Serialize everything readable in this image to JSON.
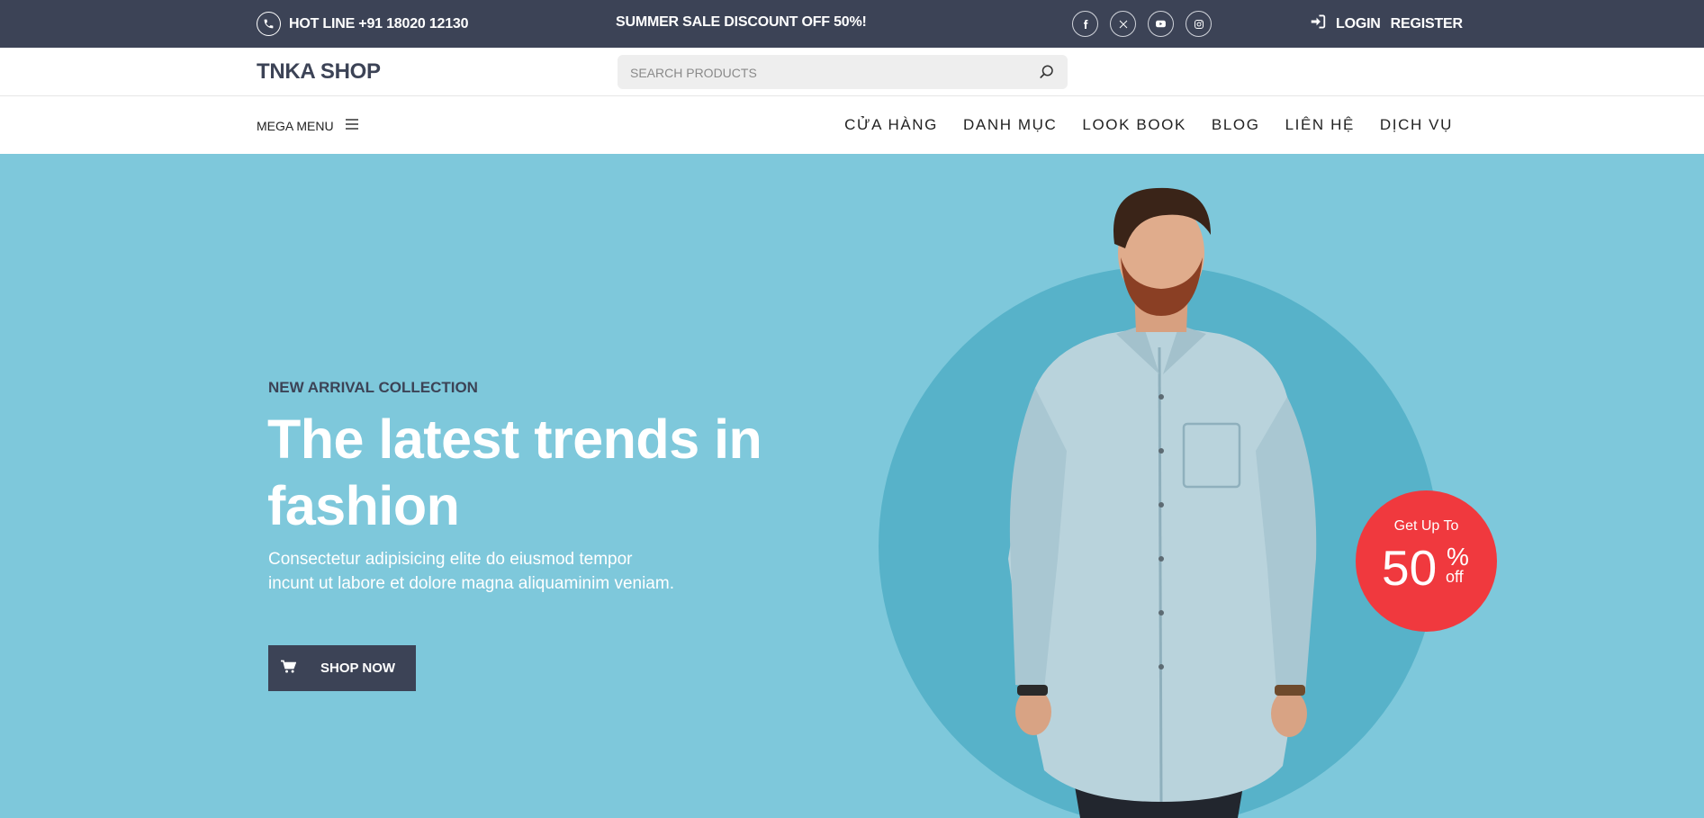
{
  "topbar": {
    "hotline": "HOT LINE +91 18020 12130",
    "promo": "SUMMER SALE DISCOUNT OFF 50%!",
    "social_icons": [
      "facebook-icon",
      "x-icon",
      "youtube-icon",
      "instagram-icon"
    ],
    "login_label": "LOGIN",
    "register_label": "REGISTER"
  },
  "header": {
    "logo": "TNKA SHOP",
    "search_placeholder": "SEARCH PRODUCTS"
  },
  "nav": {
    "mega_menu_label": "MEGA MENU",
    "items": [
      {
        "label": "CỬA HÀNG"
      },
      {
        "label": "DANH MỤC"
      },
      {
        "label": "LOOK BOOK"
      },
      {
        "label": "BLOG"
      },
      {
        "label": "LIÊN HỆ"
      },
      {
        "label": "DỊCH VỤ"
      }
    ]
  },
  "hero": {
    "subtitle": "NEW ARRIVAL COLLECTION",
    "title": "The latest trends in fashion",
    "description": "Consectetur adipisicing elite do eiusmod tempor incunt ut labore et dolore magna aliquaminim veniam.",
    "button_label": "SHOP NOW",
    "badge": {
      "line1": "Get Up To",
      "number": "50",
      "percent": "%",
      "off": "off"
    }
  },
  "colors": {
    "dark": "#3c4356",
    "hero_bg": "#7ec8db",
    "circle": "#57b2c9",
    "badge": "#f0393e"
  }
}
